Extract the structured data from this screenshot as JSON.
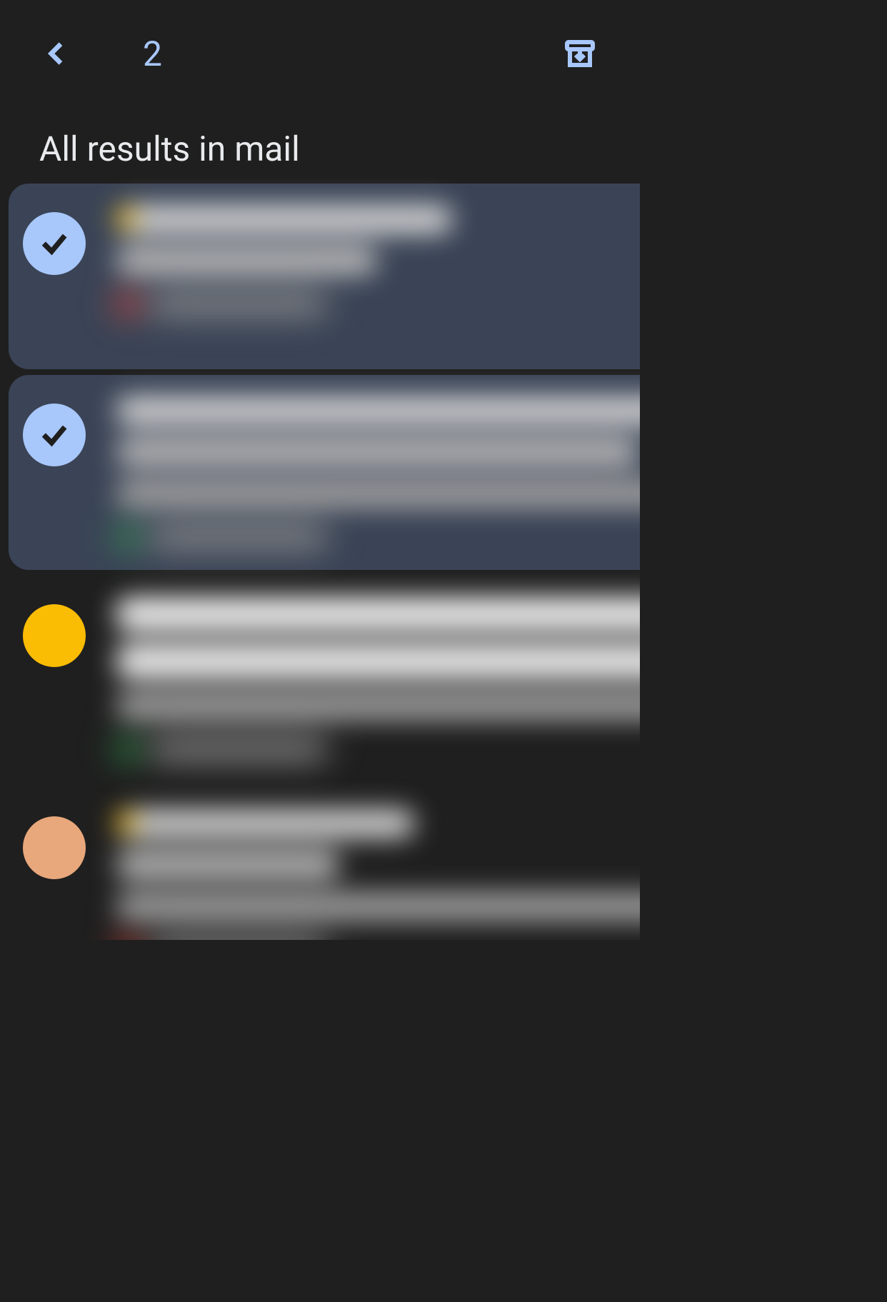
{
  "header": {
    "selection_count": "2"
  },
  "section_title": "All results in mail",
  "icons": {
    "back": "back-icon",
    "archive": "archive-icon",
    "delete": "delete-icon",
    "mark_unread": "mark-unread-icon",
    "more": "more-icon",
    "check": "check-icon"
  },
  "colors": {
    "accent": "#a8c7fa",
    "background": "#1f1f1f",
    "selected_bg": "#3a4456"
  },
  "items": [
    {
      "selected": true,
      "avatar_color": null,
      "has_star": true,
      "label_color": "red"
    },
    {
      "selected": true,
      "avatar_color": null,
      "has_star": false,
      "label_color": "green"
    },
    {
      "selected": false,
      "avatar_color": "yellow",
      "has_star": false,
      "label_color": "green",
      "bold": true
    },
    {
      "selected": false,
      "avatar_color": "skin",
      "has_star": true,
      "label_color": "red"
    }
  ]
}
